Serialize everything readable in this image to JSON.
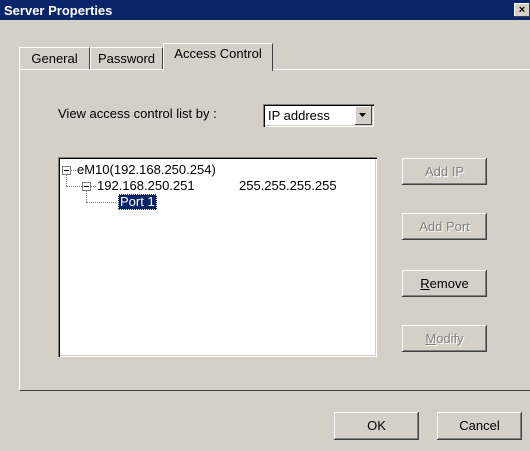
{
  "window": {
    "title": "Server Properties",
    "close_label": "×"
  },
  "tabs": [
    {
      "label": "General",
      "active": false
    },
    {
      "label": "Password",
      "active": false
    },
    {
      "label": "Access Control",
      "active": true
    }
  ],
  "view_by": {
    "label": "View access control list by :",
    "selected": "IP address"
  },
  "tree": {
    "root": "eM10(192.168.250.254)",
    "child_ip": "192.168.250.251",
    "child_mask": "255.255.255.255",
    "leaf": "Port 1"
  },
  "actions": {
    "add_ip": "Add IP",
    "add_port": "Add Port",
    "remove_first": "R",
    "remove_rest": "emove",
    "modify_first": "M",
    "modify_rest": "odify"
  },
  "footer": {
    "ok": "OK",
    "cancel": "Cancel"
  }
}
